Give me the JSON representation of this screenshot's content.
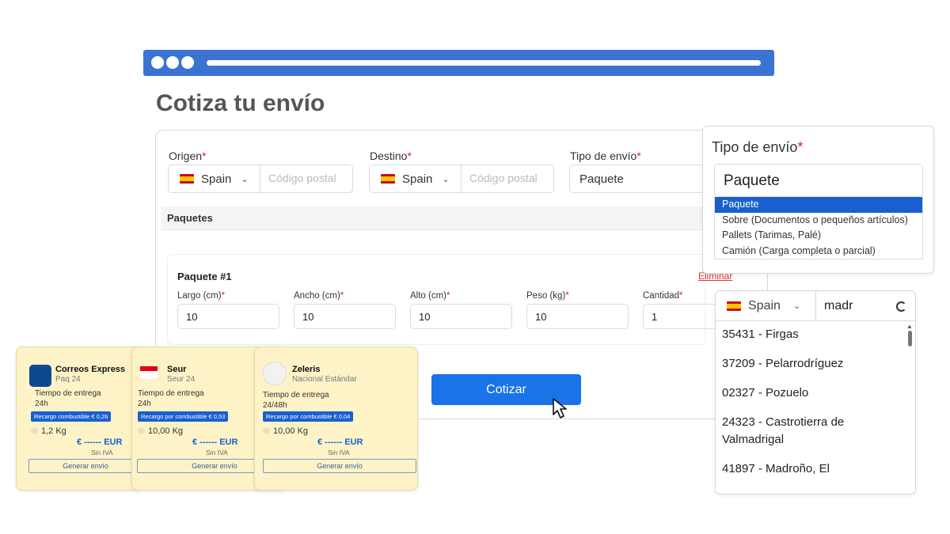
{
  "page": {
    "title": "Cotiza tu envío"
  },
  "form": {
    "origen_label": "Origen",
    "destino_label": "Destino",
    "tipo_label": "Tipo de envío",
    "required_mark": "*",
    "origen_country": "Spain",
    "destino_country": "Spain",
    "postal_placeholder": "Código postal",
    "tipo_value": "Paquete",
    "paquetes_header": "Paquetes",
    "package": {
      "title": "Paquete #1",
      "remove_label": "Eliminar",
      "fields": [
        {
          "label": "Largo (cm)",
          "value": "10",
          "required": "*"
        },
        {
          "label": "Ancho (cm)",
          "value": "10",
          "required": "*"
        },
        {
          "label": "Alto (cm)",
          "value": "10",
          "required": "*"
        },
        {
          "label": "Peso (kg)",
          "value": "10",
          "required": "*"
        },
        {
          "label": "Cantidad",
          "value": "1",
          "required": "*"
        }
      ]
    },
    "submit_label": "Cotizar"
  },
  "tipo_dropdown": {
    "label": "Tipo de envío",
    "value": "Paquete",
    "options": [
      "Paquete",
      "Sobre (Documentos o pequeños artículos)",
      "Pallets (Tarimas, Palé)",
      "Camión (Carga completa o parcial)"
    ],
    "selected_index": 0
  },
  "postal_search": {
    "country": "Spain",
    "query": "madr",
    "results": [
      "35431 - Firgas",
      "37209 - Pelarrodríguez",
      "02327 - Pozuelo",
      "24323 - Castrotierra de Valmadrigal",
      "41897 - Madroño, El"
    ]
  },
  "carriers": [
    {
      "name": "Correos Express",
      "service": "Paq 24",
      "time_label": "Tiempo de entrega",
      "time": "24h",
      "surcharge": "Recargo combustible € 0,26",
      "weight": "1,2 Kg",
      "price": "€ ------ EUR",
      "tax_note": "Sin IVA",
      "action": "Generar envío",
      "color": "#0b4a8f"
    },
    {
      "name": "Seur",
      "service": "Seur 24",
      "time_label": "Tiempo de entrega",
      "time": "24h",
      "surcharge": "Recargo por combustible € 0,53",
      "weight": "10,00 Kg",
      "price": "€ ------ EUR",
      "tax_note": "Sin IVA",
      "action": "Generar envío",
      "color": "#e2001a"
    },
    {
      "name": "Zeleris",
      "service": "Nacional Estándar",
      "time_label": "Tiempo de entrega",
      "time": "24/48h",
      "surcharge": "Recargo por combustible € 0,04",
      "weight": "10,00 Kg",
      "price": "€ ------ EUR",
      "tax_note": "Sin IVA",
      "action": "Generar envío",
      "color": "#777777"
    }
  ],
  "colors": {
    "accent": "#1a73e8",
    "browser_bar": "#3a73d2",
    "card_bg": "#fdf3c7",
    "required": "#dd2222"
  }
}
